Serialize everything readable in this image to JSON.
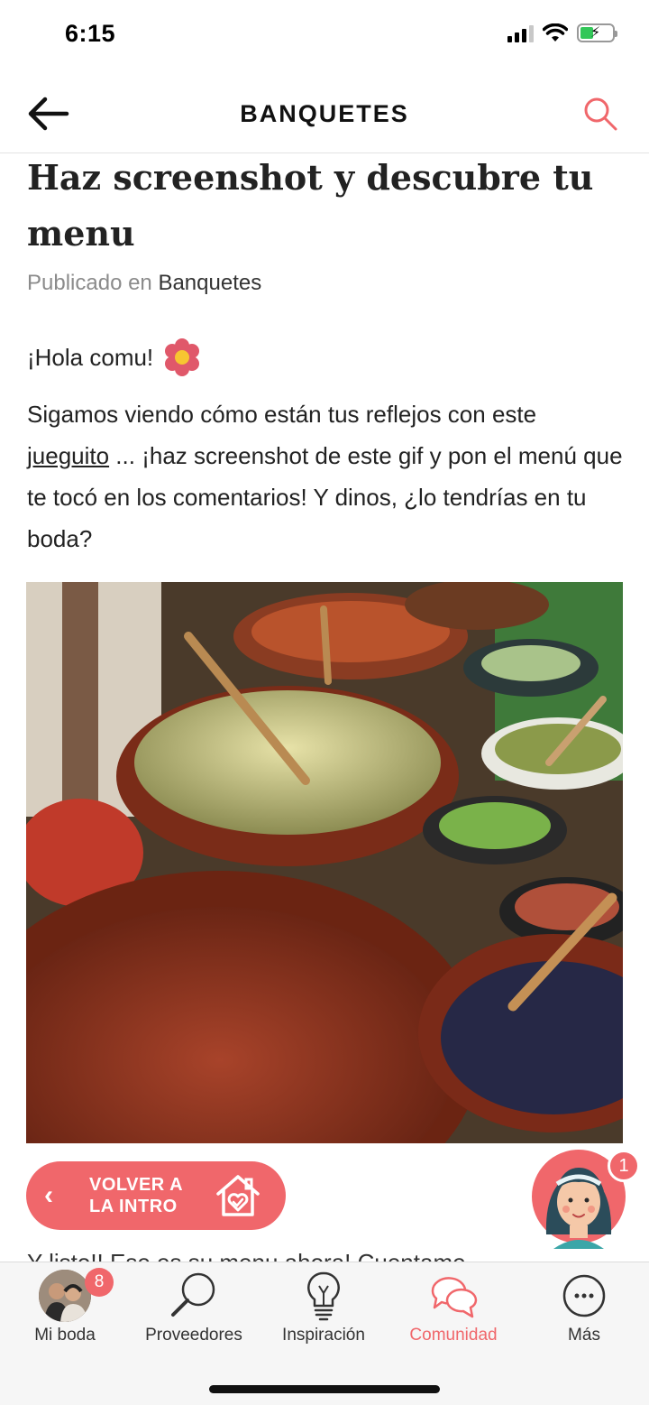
{
  "status_bar": {
    "time": "6:15"
  },
  "header": {
    "title": "BANQUETES"
  },
  "article": {
    "title": "Haz screenshot y descubre tu menu",
    "published_prefix": "Publicado en",
    "published_category": "Banquetes",
    "greeting": "¡Hola comu!",
    "body_part1": "Sigamos viendo cómo están tus reflejos con este ",
    "body_link": "jueguito",
    "body_part2": " ... ¡haz screenshot de este gif y pon el menú que te tocó en los comentarios! Y dinos, ¿lo tendrías en tu boda?",
    "cut_line": "Y listo!! Ese es su menu ahora! Cuentame"
  },
  "volver": {
    "line1": "VOLVER A",
    "line2": "LA INTRO"
  },
  "assistant": {
    "badge": "1"
  },
  "tabs": [
    {
      "label": "Mi boda",
      "badge": "8",
      "icon": "avatar-photo"
    },
    {
      "label": "Proveedores",
      "icon": "magnifier-icon"
    },
    {
      "label": "Inspiración",
      "icon": "lightbulb-icon"
    },
    {
      "label": "Comunidad",
      "icon": "chat-bubbles-icon",
      "active": true
    },
    {
      "label": "Más",
      "icon": "more-dots-icon"
    }
  ],
  "colors": {
    "accent": "#f0676b",
    "text": "#222222"
  }
}
